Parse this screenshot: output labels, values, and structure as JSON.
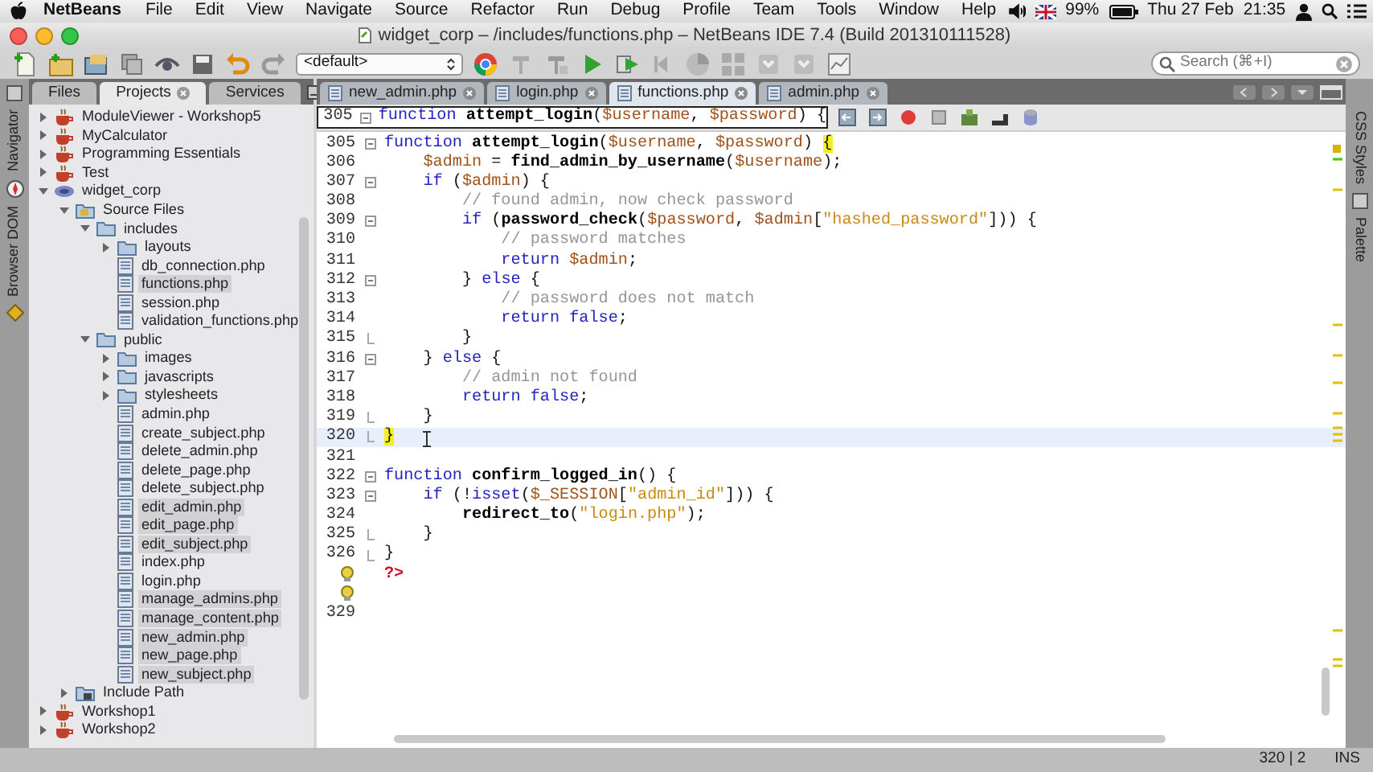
{
  "menu_bar": {
    "app": "NetBeans",
    "items": [
      "File",
      "Edit",
      "View",
      "Navigate",
      "Source",
      "Refactor",
      "Run",
      "Debug",
      "Profile",
      "Team",
      "Tools",
      "Window",
      "Help"
    ],
    "battery": "99%",
    "date": "Thu 27 Feb",
    "time": "21:35"
  },
  "window": {
    "title": "widget_corp – /includes/functions.php – NetBeans IDE 7.4 (Build 201310111528)"
  },
  "toolbar": {
    "configuration": "<default>",
    "search": {
      "placeholder": "Search (⌘+I)"
    }
  },
  "side_left": [
    "Navigator",
    "Browser DOM"
  ],
  "side_right": [
    "CSS Styles",
    "Palette"
  ],
  "panel_tabs": [
    {
      "label": "Files",
      "selected": false
    },
    {
      "label": "Projects",
      "selected": true
    },
    {
      "label": "Services",
      "selected": false
    }
  ],
  "project_tree": [
    {
      "label": "ModuleViewer - Workshop5",
      "kind": "project",
      "expanded": false,
      "selected": false
    },
    {
      "label": "MyCalculator",
      "kind": "project",
      "expanded": false,
      "selected": false
    },
    {
      "label": "Programming Essentials",
      "kind": "project",
      "expanded": false,
      "selected": false
    },
    {
      "label": "Test",
      "kind": "project",
      "expanded": false,
      "selected": false
    },
    {
      "label": "widget_corp",
      "kind": "php-project",
      "expanded": true,
      "selected": false,
      "children": [
        {
          "label": "Source Files",
          "kind": "source",
          "expanded": true,
          "selected": false,
          "children": [
            {
              "label": "includes",
              "kind": "folder",
              "expanded": true,
              "selected": false,
              "children": [
                {
                  "label": "layouts",
                  "kind": "folder",
                  "expanded": false,
                  "selected": false
                },
                {
                  "label": "db_connection.php",
                  "kind": "file",
                  "selected": false
                },
                {
                  "label": "functions.php",
                  "kind": "file",
                  "selected": true
                },
                {
                  "label": "session.php",
                  "kind": "file",
                  "selected": false
                },
                {
                  "label": "validation_functions.php",
                  "kind": "file",
                  "selected": false
                }
              ]
            },
            {
              "label": "public",
              "kind": "folder",
              "expanded": true,
              "selected": false,
              "children": [
                {
                  "label": "images",
                  "kind": "folder",
                  "expanded": false,
                  "selected": false
                },
                {
                  "label": "javascripts",
                  "kind": "folder",
                  "expanded": false,
                  "selected": false
                },
                {
                  "label": "stylesheets",
                  "kind": "folder",
                  "expanded": false,
                  "selected": false
                },
                {
                  "label": "admin.php",
                  "kind": "file",
                  "selected": false
                },
                {
                  "label": "create_subject.php",
                  "kind": "file",
                  "selected": false
                },
                {
                  "label": "delete_admin.php",
                  "kind": "file",
                  "selected": false
                },
                {
                  "label": "delete_page.php",
                  "kind": "file",
                  "selected": false
                },
                {
                  "label": "delete_subject.php",
                  "kind": "file",
                  "selected": false
                },
                {
                  "label": "edit_admin.php",
                  "kind": "file",
                  "selected": true
                },
                {
                  "label": "edit_page.php",
                  "kind": "file",
                  "selected": true
                },
                {
                  "label": "edit_subject.php",
                  "kind": "file",
                  "selected": true
                },
                {
                  "label": "index.php",
                  "kind": "file",
                  "selected": false
                },
                {
                  "label": "login.php",
                  "kind": "file",
                  "selected": false
                },
                {
                  "label": "manage_admins.php",
                  "kind": "file",
                  "selected": true
                },
                {
                  "label": "manage_content.php",
                  "kind": "file",
                  "selected": true
                },
                {
                  "label": "new_admin.php",
                  "kind": "file",
                  "selected": true
                },
                {
                  "label": "new_page.php",
                  "kind": "file",
                  "selected": true
                },
                {
                  "label": "new_subject.php",
                  "kind": "file",
                  "selected": true
                }
              ]
            }
          ]
        },
        {
          "label": "Include Path",
          "kind": "include-path",
          "expanded": false,
          "selected": false
        }
      ]
    },
    {
      "label": "Workshop1",
      "kind": "project",
      "expanded": false,
      "selected": false
    },
    {
      "label": "Workshop2",
      "kind": "project",
      "expanded": false,
      "selected": false
    }
  ],
  "editor_tabs": [
    {
      "label": "new_admin.php",
      "selected": false
    },
    {
      "label": "login.php",
      "selected": false
    },
    {
      "label": "functions.php",
      "selected": true
    },
    {
      "label": "admin.php",
      "selected": false
    }
  ],
  "editor": {
    "header": {
      "number": "305",
      "fold_start": true,
      "fold_end": false,
      "tokens": [
        {
          "kind": "kw",
          "text": "function "
        },
        {
          "kind": "fn",
          "text": "attempt_login"
        },
        {
          "kind": "plain",
          "text": "("
        },
        {
          "kind": "var",
          "text": "$username"
        },
        {
          "kind": "plain",
          "text": ", "
        },
        {
          "kind": "var",
          "text": "$password"
        },
        {
          "kind": "plain",
          "text": ") {"
        }
      ]
    },
    "lines": [
      {
        "number": "305",
        "fold_start": true,
        "fold_end": false,
        "current": false,
        "hint": false,
        "tokens": [
          {
            "kind": "kw",
            "text": "function "
          },
          {
            "kind": "fn",
            "text": "attempt_login"
          },
          {
            "kind": "plain",
            "text": "("
          },
          {
            "kind": "var",
            "text": "$username"
          },
          {
            "kind": "plain",
            "text": ", "
          },
          {
            "kind": "var",
            "text": "$password"
          },
          {
            "kind": "plain",
            "text": ") "
          },
          {
            "kind": "brace-match",
            "text": "{"
          }
        ]
      },
      {
        "number": "306",
        "fold_start": false,
        "fold_end": false,
        "current": false,
        "hint": false,
        "tokens": [
          {
            "kind": "var",
            "text": "    $admin"
          },
          {
            "kind": "plain",
            "text": " = "
          },
          {
            "kind": "fn",
            "text": "find_admin_by_username"
          },
          {
            "kind": "plain",
            "text": "("
          },
          {
            "kind": "var",
            "text": "$username"
          },
          {
            "kind": "plain",
            "text": ");"
          }
        ]
      },
      {
        "number": "307",
        "fold_start": true,
        "fold_end": false,
        "current": false,
        "hint": false,
        "tokens": [
          {
            "kind": "kw",
            "text": "    if"
          },
          {
            "kind": "plain",
            "text": " ("
          },
          {
            "kind": "var",
            "text": "$admin"
          },
          {
            "kind": "plain",
            "text": ") {"
          }
        ]
      },
      {
        "number": "308",
        "fold_start": false,
        "fold_end": false,
        "current": false,
        "hint": false,
        "tokens": [
          {
            "kind": "cmt",
            "text": "        // found admin, now check password"
          }
        ]
      },
      {
        "number": "309",
        "fold_start": true,
        "fold_end": false,
        "current": false,
        "hint": false,
        "tokens": [
          {
            "kind": "kw",
            "text": "        if"
          },
          {
            "kind": "plain",
            "text": " ("
          },
          {
            "kind": "fn",
            "text": "password_check"
          },
          {
            "kind": "plain",
            "text": "("
          },
          {
            "kind": "var",
            "text": "$password"
          },
          {
            "kind": "plain",
            "text": ", "
          },
          {
            "kind": "var",
            "text": "$admin"
          },
          {
            "kind": "plain",
            "text": "["
          },
          {
            "kind": "str",
            "text": "\"hashed_password\""
          },
          {
            "kind": "plain",
            "text": "])) {"
          }
        ]
      },
      {
        "number": "310",
        "fold_start": false,
        "fold_end": false,
        "current": false,
        "hint": false,
        "tokens": [
          {
            "kind": "cmt",
            "text": "            // password matches"
          }
        ]
      },
      {
        "number": "311",
        "fold_start": false,
        "fold_end": false,
        "current": false,
        "hint": false,
        "tokens": [
          {
            "kind": "kw",
            "text": "            return "
          },
          {
            "kind": "var",
            "text": "$admin"
          },
          {
            "kind": "plain",
            "text": ";"
          }
        ]
      },
      {
        "number": "312",
        "fold_start": true,
        "fold_end": false,
        "current": false,
        "hint": false,
        "tokens": [
          {
            "kind": "plain",
            "text": "        } "
          },
          {
            "kind": "kw",
            "text": "else"
          },
          {
            "kind": "plain",
            "text": " {"
          }
        ]
      },
      {
        "number": "313",
        "fold_start": false,
        "fold_end": false,
        "current": false,
        "hint": false,
        "tokens": [
          {
            "kind": "cmt",
            "text": "            // password does not match"
          }
        ]
      },
      {
        "number": "314",
        "fold_start": false,
        "fold_end": false,
        "current": false,
        "hint": false,
        "tokens": [
          {
            "kind": "kw",
            "text": "            return false"
          },
          {
            "kind": "plain",
            "text": ";"
          }
        ]
      },
      {
        "number": "315",
        "fold_start": false,
        "fold_end": true,
        "current": false,
        "hint": false,
        "tokens": [
          {
            "kind": "plain",
            "text": "        }"
          }
        ]
      },
      {
        "number": "316",
        "fold_start": true,
        "fold_end": false,
        "current": false,
        "hint": false,
        "tokens": [
          {
            "kind": "plain",
            "text": "    } "
          },
          {
            "kind": "kw",
            "text": "else"
          },
          {
            "kind": "plain",
            "text": " {"
          }
        ]
      },
      {
        "number": "317",
        "fold_start": false,
        "fold_end": false,
        "current": false,
        "hint": false,
        "tokens": [
          {
            "kind": "cmt",
            "text": "        // admin not found"
          }
        ]
      },
      {
        "number": "318",
        "fold_start": false,
        "fold_end": false,
        "current": false,
        "hint": false,
        "tokens": [
          {
            "kind": "kw",
            "text": "        return false"
          },
          {
            "kind": "plain",
            "text": ";"
          }
        ]
      },
      {
        "number": "319",
        "fold_start": false,
        "fold_end": true,
        "current": false,
        "hint": false,
        "tokens": [
          {
            "kind": "plain",
            "text": "    }"
          }
        ]
      },
      {
        "number": "320",
        "fold_start": false,
        "fold_end": true,
        "current": true,
        "hint": false,
        "tokens": [
          {
            "kind": "brace-match",
            "text": "}"
          }
        ]
      },
      {
        "number": "321",
        "fold_start": false,
        "fold_end": false,
        "current": false,
        "hint": false
      },
      {
        "number": "322",
        "fold_start": true,
        "fold_end": false,
        "current": false,
        "hint": false,
        "tokens": [
          {
            "kind": "kw",
            "text": "function "
          },
          {
            "kind": "fn",
            "text": "confirm_logged_in"
          },
          {
            "kind": "plain",
            "text": "() {"
          }
        ]
      },
      {
        "number": "323",
        "fold_start": true,
        "fold_end": false,
        "current": false,
        "hint": false,
        "tokens": [
          {
            "kind": "kw",
            "text": "    if"
          },
          {
            "kind": "plain",
            "text": " (!"
          },
          {
            "kind": "kw",
            "text": "isset"
          },
          {
            "kind": "plain",
            "text": "("
          },
          {
            "kind": "var",
            "text": "$_SESSION"
          },
          {
            "kind": "plain",
            "text": "["
          },
          {
            "kind": "str",
            "text": "\"admin_id\""
          },
          {
            "kind": "plain",
            "text": "])) {"
          }
        ]
      },
      {
        "number": "324",
        "fold_start": false,
        "fold_end": false,
        "current": false,
        "hint": false,
        "tokens": [
          {
            "kind": "fn",
            "text": "        redirect_to"
          },
          {
            "kind": "plain",
            "text": "("
          },
          {
            "kind": "str",
            "text": "\"login.php\""
          },
          {
            "kind": "plain",
            "text": ");"
          }
        ]
      },
      {
        "number": "325",
        "fold_start": false,
        "fold_end": true,
        "current": false,
        "hint": false,
        "tokens": [
          {
            "kind": "plain",
            "text": "    }"
          }
        ]
      },
      {
        "number": "326",
        "fold_start": false,
        "fold_end": true,
        "current": false,
        "hint": false,
        "tokens": [
          {
            "kind": "plain",
            "text": "}"
          }
        ]
      },
      {
        "fold_start": false,
        "fold_end": false,
        "current": false,
        "hint": true,
        "tokens": [
          {
            "kind": "tag",
            "text": "?>"
          }
        ]
      },
      {
        "fold_start": false,
        "fold_end": false,
        "current": false,
        "hint": true
      },
      {
        "number": "329",
        "fold_start": false,
        "fold_end": false,
        "current": false,
        "hint": false
      }
    ]
  },
  "status_bar": {
    "position": "320 | 2",
    "mode": "INS"
  }
}
